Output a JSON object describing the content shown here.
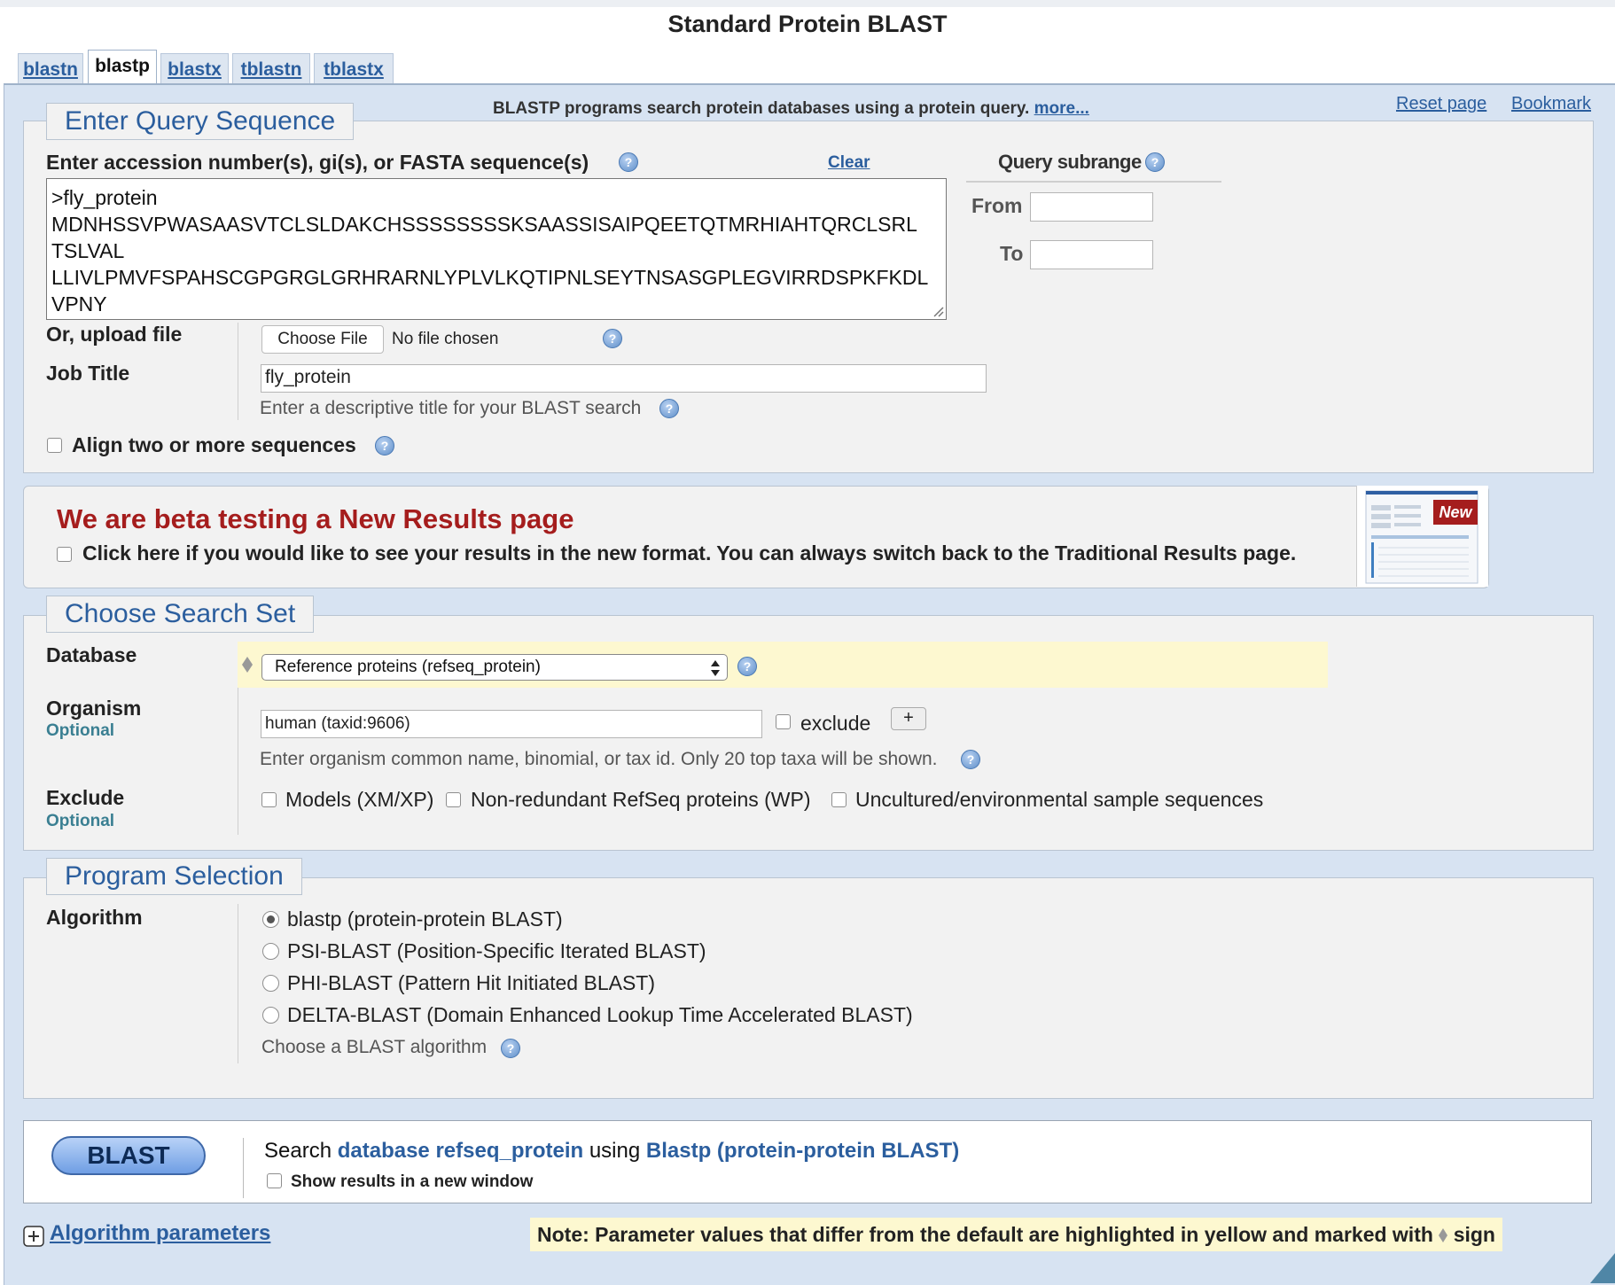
{
  "page_title": "Standard Protein BLAST",
  "tabs": [
    {
      "label": "blastn"
    },
    {
      "label": "blastp"
    },
    {
      "label": "blastx"
    },
    {
      "label": "tblastn"
    },
    {
      "label": "tblastx"
    }
  ],
  "header": {
    "description": "BLASTP programs search protein databases using a protein query.",
    "more_link": "more...",
    "reset_link": "Reset page",
    "bookmark_link": "Bookmark"
  },
  "query": {
    "legend": "Enter Query Sequence",
    "input_label": "Enter accession number(s), gi(s), or FASTA sequence(s)",
    "clear_link": "Clear",
    "sequence_lines": [
      ">fly_protein",
      "MDNHSSVPWASAASVTCLSLDAKCHSSSSSSSSKSAASSISAIPQEETQTMRHIAHTQRCLSRL",
      "TSLVAL",
      "LLIVLPMVFSPAHSCGPGRGLGRHRARNLYPLVLKQTIPNLSEYTNSASGPLEGVIRRDSPKFKDL",
      "VPNY"
    ],
    "subrange_title": "Query subrange",
    "from_label": "From",
    "to_label": "To",
    "from_value": "",
    "to_value": "",
    "upload_label": "Or, upload file",
    "choose_file_label": "Choose File",
    "no_file_text": "No file chosen",
    "job_title_label": "Job Title",
    "job_title_value": "fly_protein",
    "job_title_hint": "Enter a descriptive title for your BLAST search",
    "align_label": "Align two or more sequences"
  },
  "beta": {
    "heading": "We are beta testing a New Results page",
    "checkbox_text": "Click here if you would like to see your results in the new format. You can always switch back to the Traditional Results page.",
    "badge": "New"
  },
  "search_set": {
    "legend": "Choose Search Set",
    "database_label": "Database",
    "database_value": "Reference proteins (refseq_protein)",
    "organism_label": "Organism",
    "optional_text": "Optional",
    "organism_value": "human (taxid:9606)",
    "exclude_label_inline": "exclude",
    "add_button": "+",
    "organism_hint": "Enter organism common name, binomial, or tax id. Only 20 top taxa will be shown.",
    "exclude_label": "Exclude",
    "exclude_options": [
      "Models (XM/XP)",
      "Non-redundant RefSeq proteins (WP)",
      "Uncultured/environmental sample sequences"
    ]
  },
  "program": {
    "legend": "Program Selection",
    "algorithm_label": "Algorithm",
    "options": [
      "blastp (protein-protein BLAST)",
      "PSI-BLAST (Position-Specific Iterated BLAST)",
      "PHI-BLAST (Pattern Hit Initiated BLAST)",
      "DELTA-BLAST (Domain Enhanced Lookup Time Accelerated BLAST)"
    ],
    "selected_index": 0,
    "hint": "Choose a BLAST algorithm"
  },
  "submit": {
    "button": "BLAST",
    "search_word": "Search",
    "database_phrase": "database refseq_protein",
    "using_word": "using",
    "program_phrase": "Blastp (protein-protein BLAST)",
    "new_window_label": "Show results in a new window"
  },
  "footer": {
    "algo_params_link": "Algorithm parameters",
    "note_prefix": "Note: Parameter values that differ from the default are highlighted in yellow and marked with",
    "note_suffix": "sign"
  },
  "colors": {
    "link_blue": "#2b5e9e",
    "beta_red": "#a51d1d",
    "highlight_yellow": "#fdf8d0",
    "page_blue": "#d7e3f2"
  },
  "icons": [
    "help-icon",
    "diamond-marker-icon",
    "plus-expand-icon",
    "corner-icon"
  ]
}
